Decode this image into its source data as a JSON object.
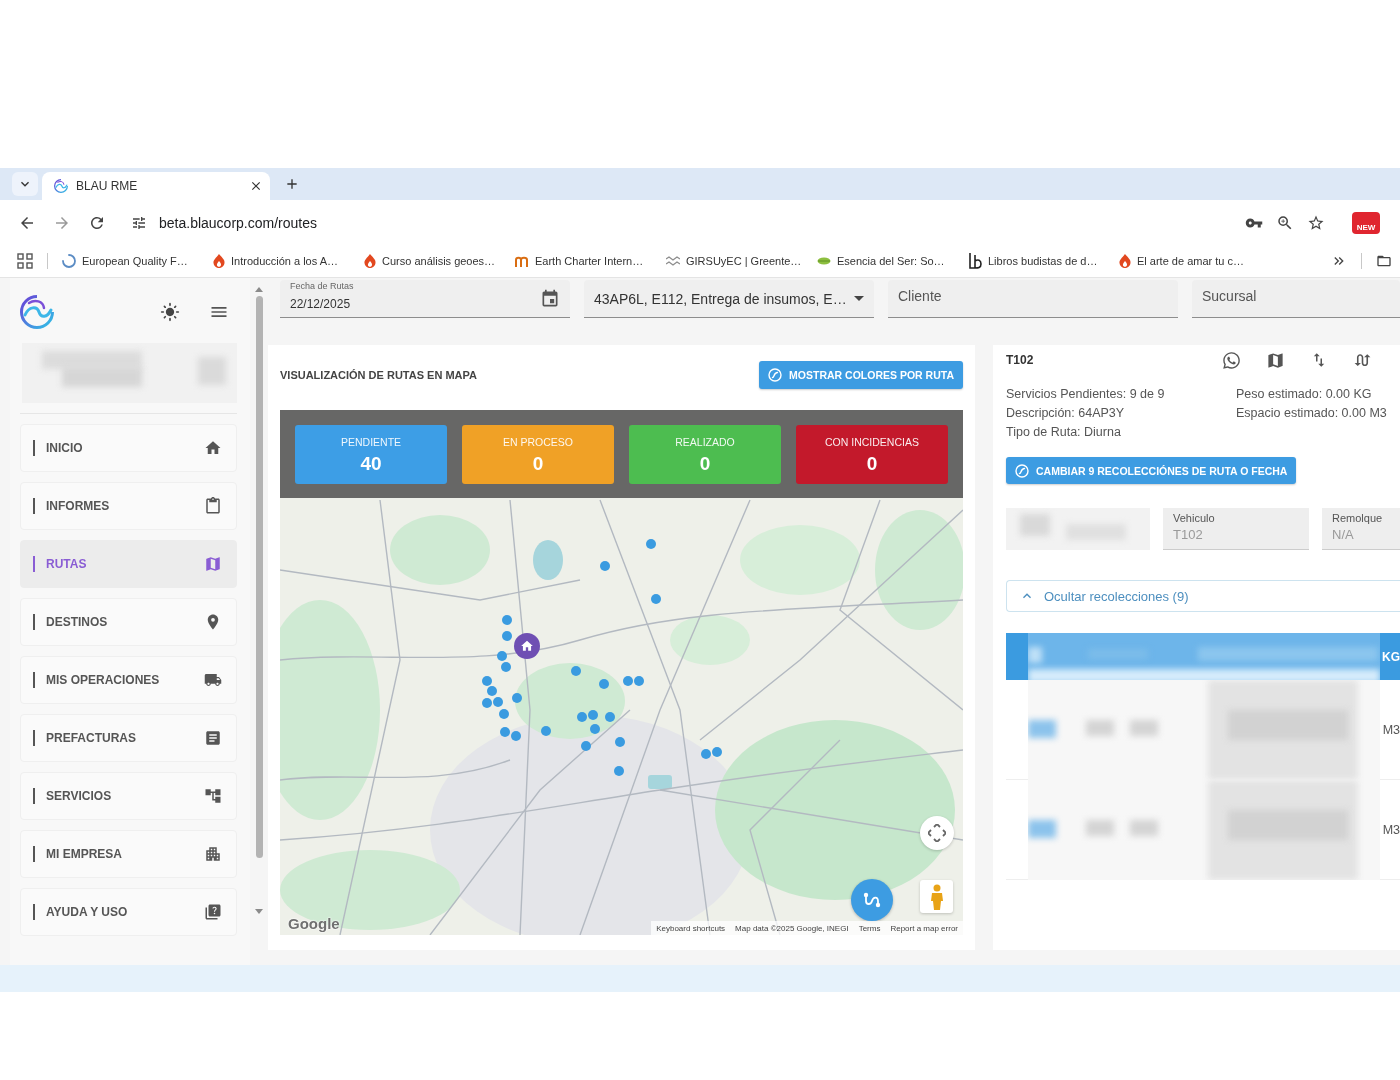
{
  "browser": {
    "tab": {
      "title": "BLAU RME"
    },
    "url": "beta.blaucorp.com/routes",
    "extension_badge": "NEW",
    "bookmarks": [
      {
        "label": "European Quality F…",
        "kind": "spinner"
      },
      {
        "label": "Introducción a los A…",
        "kind": "flame"
      },
      {
        "label": "Curso análisis geoes…",
        "kind": "flame"
      },
      {
        "label": "Earth Charter Intern…",
        "kind": "arches"
      },
      {
        "label": "GIRSUyEC | Greente…",
        "kind": "wave"
      },
      {
        "label": "Esencia del Ser: So…",
        "kind": "leaf"
      },
      {
        "label": "Libros budistas de d…",
        "kind": "bars"
      },
      {
        "label": "El arte de amar tu c…",
        "kind": "flame"
      }
    ]
  },
  "sidebar": {
    "items": [
      {
        "label": "INICIO",
        "kind": "home",
        "selected": false
      },
      {
        "label": "INFORMES",
        "kind": "clipboard",
        "selected": false
      },
      {
        "label": "RUTAS",
        "kind": "map",
        "selected": true
      },
      {
        "label": "DESTINOS",
        "kind": "pin",
        "selected": false
      },
      {
        "label": "MIS OPERACIONES",
        "kind": "truck",
        "selected": false
      },
      {
        "label": "PREFACTURAS",
        "kind": "document",
        "selected": false
      },
      {
        "label": "SERVICIOS",
        "kind": "tree",
        "selected": false
      },
      {
        "label": "MI EMPRESA",
        "kind": "buildings",
        "selected": false
      },
      {
        "label": "AYUDA Y USO",
        "kind": "help",
        "selected": false
      }
    ]
  },
  "filters": {
    "date": {
      "label": "Fecha de Rutas",
      "value": "22/12/2025"
    },
    "routes": {
      "value": "43AP6L, E112, Entrega de insumos, E…"
    },
    "client": {
      "placeholder": "Cliente"
    },
    "branch": {
      "placeholder": "Sucursal"
    }
  },
  "map_panel": {
    "title": "VISUALIZACIÓN DE RUTAS EN MAPA",
    "button": "MOSTRAR COLORES POR RUTA",
    "status_cards": [
      {
        "label": "PENDIENTE",
        "count": "40",
        "color": "#3d9ee6"
      },
      {
        "label": "EN PROCESO",
        "count": "0",
        "color": "#f0a126"
      },
      {
        "label": "REALIZADO",
        "count": "0",
        "color": "#4dbd50"
      },
      {
        "label": "CON INCIDENCIAS",
        "count": "0",
        "color": "#c3192b"
      }
    ],
    "map": {
      "logo": "Google",
      "attribution": [
        "Keyboard shortcuts",
        "Map data ©2025 Google, INEGI",
        "Terms",
        "Report a map error"
      ]
    }
  },
  "route_panel": {
    "title": "T102",
    "details_left": [
      "Servicios Pendientes: 9 de 9",
      "Descripción: 64AP3Y",
      "Tipo de Ruta: Diurna"
    ],
    "details_right": [
      "Peso estimado: 0.00 KG",
      "Espacio estimado: 0.00 M3"
    ],
    "button": "CAMBIAR 9 RECOLECCIÓNES DE RUTA O FECHA",
    "fields": [
      {
        "label": "Vehiculo",
        "value": "T102",
        "disabled": true
      },
      {
        "label": "Remolque",
        "value": "N/A",
        "disabled": true
      }
    ],
    "toggle": {
      "label": "Ocultar recolecciones (9)",
      "expanded": true
    },
    "table": {
      "columns": [
        "KG"
      ],
      "rows": [
        [
          "M3"
        ],
        [
          "M3"
        ]
      ]
    }
  }
}
